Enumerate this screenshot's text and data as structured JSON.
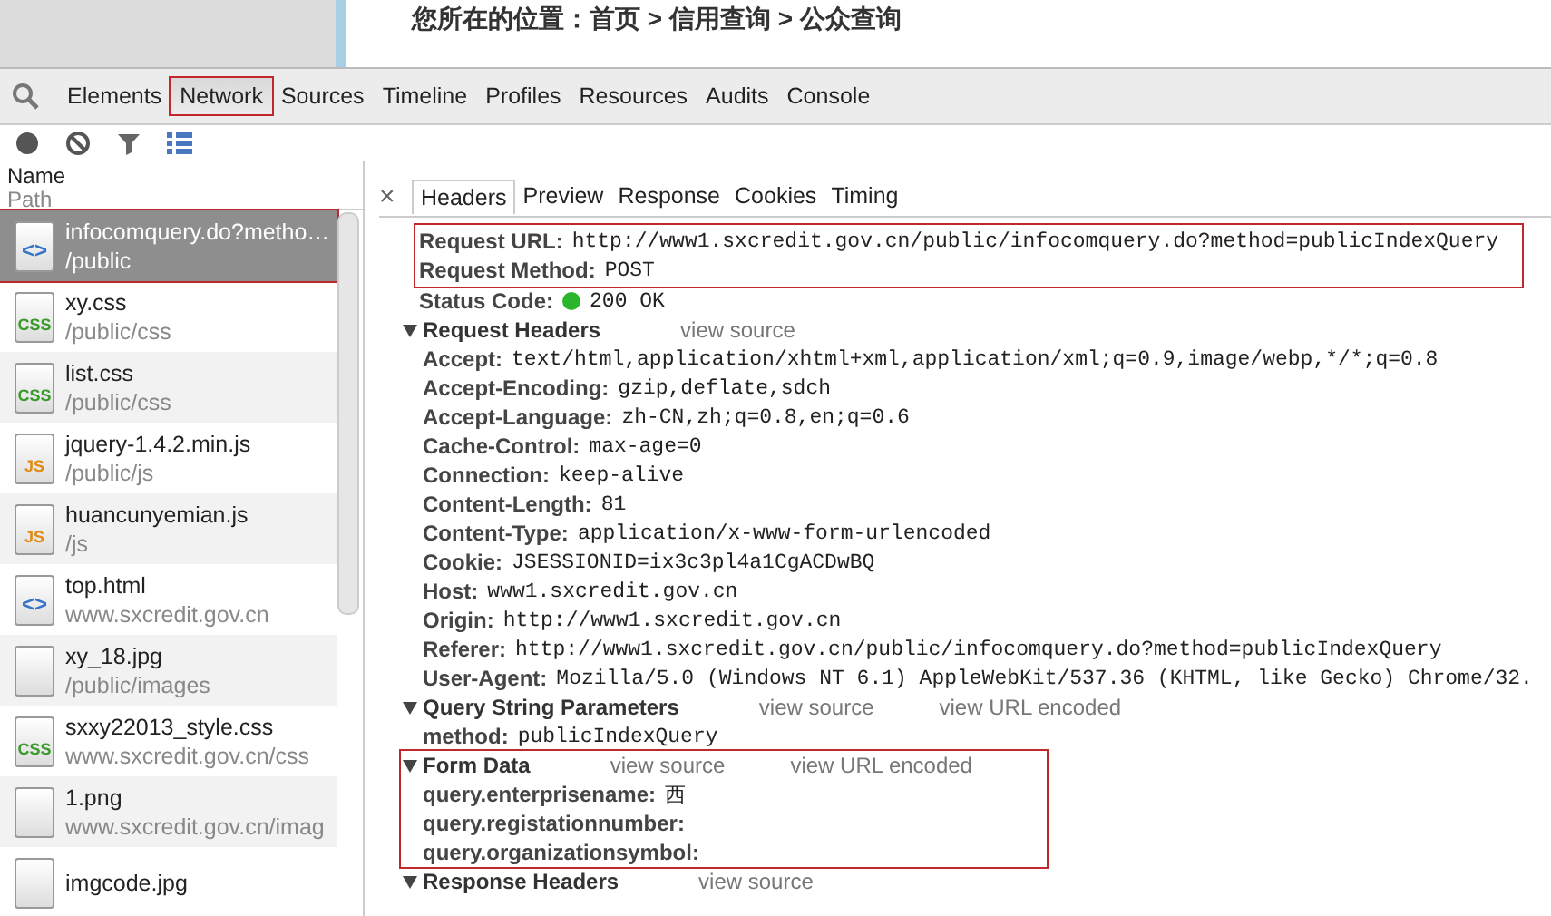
{
  "page_behind": {
    "breadcrumb": "您所在的位置：首页 > 信用查询 > 公众查询"
  },
  "devtools_tabs": [
    {
      "label": "Elements",
      "selected": false,
      "annotated": false
    },
    {
      "label": "Network",
      "selected": true,
      "annotated": true
    },
    {
      "label": "Sources",
      "selected": false,
      "annotated": false
    },
    {
      "label": "Timeline",
      "selected": false,
      "annotated": false
    },
    {
      "label": "Profiles",
      "selected": false,
      "annotated": false
    },
    {
      "label": "Resources",
      "selected": false,
      "annotated": false
    },
    {
      "label": "Audits",
      "selected": false,
      "annotated": false
    },
    {
      "label": "Console",
      "selected": false,
      "annotated": false
    }
  ],
  "request_list": {
    "header_name": "Name",
    "header_path": "Path",
    "items": [
      {
        "name": "infocomquery.do?metho…",
        "path": "/public",
        "kind": "html",
        "icon_label": "<>",
        "selected": true,
        "annotated": true
      },
      {
        "name": "xy.css",
        "path": "/public/css",
        "kind": "css",
        "icon_label": "CSS",
        "selected": false,
        "annotated": false
      },
      {
        "name": "list.css",
        "path": "/public/css",
        "kind": "css",
        "icon_label": "CSS",
        "selected": false,
        "annotated": false
      },
      {
        "name": "jquery-1.4.2.min.js",
        "path": "/public/js",
        "kind": "js",
        "icon_label": "JS",
        "selected": false,
        "annotated": false
      },
      {
        "name": "huancunyemian.js",
        "path": "/js",
        "kind": "js",
        "icon_label": "JS",
        "selected": false,
        "annotated": false
      },
      {
        "name": "top.html",
        "path": "www.sxcredit.gov.cn",
        "kind": "html",
        "icon_label": "<>",
        "selected": false,
        "annotated": false
      },
      {
        "name": "xy_18.jpg",
        "path": "/public/images",
        "kind": "image",
        "selected": false,
        "annotated": false
      },
      {
        "name": "sxxy22013_style.css",
        "path": "www.sxcredit.gov.cn/css",
        "kind": "css",
        "icon_label": "CSS",
        "selected": false,
        "annotated": false
      },
      {
        "name": "1.png",
        "path": "www.sxcredit.gov.cn/imag",
        "kind": "png",
        "selected": false,
        "annotated": false
      },
      {
        "name": "imgcode.jpg",
        "kind": "image",
        "selected": false,
        "annotated": false
      }
    ]
  },
  "detail_tabs": [
    {
      "label": "Headers",
      "selected": true
    },
    {
      "label": "Preview",
      "selected": false
    },
    {
      "label": "Response",
      "selected": false
    },
    {
      "label": "Cookies",
      "selected": false
    },
    {
      "label": "Timing",
      "selected": false
    }
  ],
  "close_glyph": "×",
  "general": {
    "annotated": true,
    "rows": [
      {
        "key": "Request URL:",
        "value": "http://www1.sxcredit.gov.cn/public/infocomquery.do?method=publicIndexQuery"
      },
      {
        "key": "Request Method:",
        "value": "POST"
      }
    ]
  },
  "status": {
    "key": "Status Code:",
    "value": "200 OK",
    "color": "#2bb52b"
  },
  "sections": [
    {
      "title": "Request Headers",
      "expanded": true,
      "annotated": false,
      "links": [
        "view source"
      ],
      "rows": [
        {
          "key": "Accept:",
          "value": "text/html,application/xhtml+xml,application/xml;q=0.9,image/webp,*/*;q=0.8"
        },
        {
          "key": "Accept-Encoding:",
          "value": "gzip,deflate,sdch"
        },
        {
          "key": "Accept-Language:",
          "value": "zh-CN,zh;q=0.8,en;q=0.6"
        },
        {
          "key": "Cache-Control:",
          "value": "max-age=0"
        },
        {
          "key": "Connection:",
          "value": "keep-alive"
        },
        {
          "key": "Content-Length:",
          "value": "81"
        },
        {
          "key": "Content-Type:",
          "value": "application/x-www-form-urlencoded"
        },
        {
          "key": "Cookie:",
          "value": "JSESSIONID=ix3c3pl4a1CgACDwBQ"
        },
        {
          "key": "Host:",
          "value": "www1.sxcredit.gov.cn"
        },
        {
          "key": "Origin:",
          "value": "http://www1.sxcredit.gov.cn"
        },
        {
          "key": "Referer:",
          "value": "http://www1.sxcredit.gov.cn/public/infocomquery.do?method=publicIndexQuery"
        },
        {
          "key": "User-Agent:",
          "value": "Mozilla/5.0 (Windows NT 6.1) AppleWebKit/537.36 (KHTML, like Gecko) Chrome/32."
        }
      ]
    },
    {
      "title": "Query String Parameters",
      "expanded": true,
      "annotated": false,
      "links": [
        "view source",
        "view URL encoded"
      ],
      "rows": [
        {
          "key": "method:",
          "value": "publicIndexQuery"
        }
      ]
    },
    {
      "title": "Form Data",
      "expanded": true,
      "annotated": true,
      "links": [
        "view source",
        "view URL encoded"
      ],
      "rows": [
        {
          "key": "query.enterprisename:",
          "value": "西"
        },
        {
          "key": "query.registationnumber:"
        },
        {
          "key": "query.organizationsymbol:"
        }
      ]
    },
    {
      "title": "Response Headers",
      "expanded": true,
      "annotated": false,
      "links": [
        "view source"
      ]
    }
  ]
}
